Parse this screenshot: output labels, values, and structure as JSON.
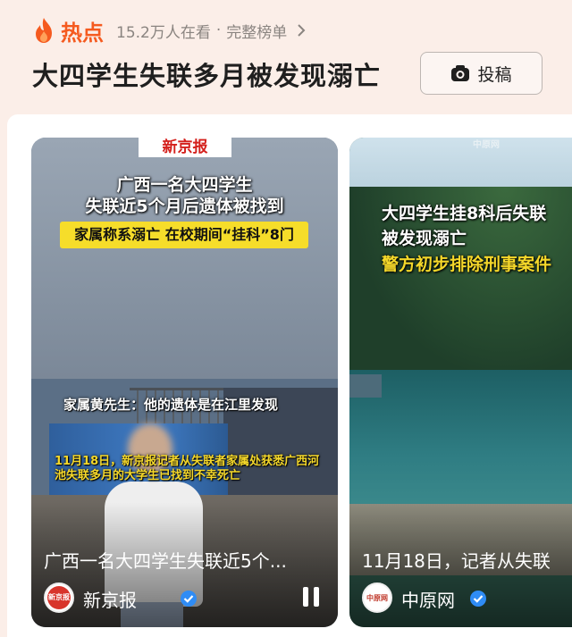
{
  "header": {
    "hot_label": "热点",
    "viewers": "15.2万人在看",
    "separator": "·",
    "full_list": "完整榜单",
    "headline": "大四学生失联多月被发现溺亡",
    "submit_label": "投稿"
  },
  "cards": [
    {
      "watermark": "新京报",
      "title_line1": "广西一名大四学生",
      "title_line2": "失联近5个月后遗体被找到",
      "highlight": "家属称系溺亡  在校期间“挂科”8门",
      "subtitle1": "家属黄先生：他的遗体是在江里发现",
      "subtitle2": "11月18日，新京报记者从失联者家属处获悉广西河池失联多月的大学生已找到不幸死亡",
      "caption": "广西一名大四学生失联近5个...",
      "source": "新京报",
      "avatar_text": "新京报"
    },
    {
      "watermark": "中原网",
      "title_line1": "大四学生挂8科后失联",
      "title_line2": "被发现溺亡",
      "title_line3": "警方初步排除刑事案件",
      "caption": "11月18日，记者从失联",
      "source": "中原网",
      "avatar_text": "中原网"
    }
  ],
  "colors": {
    "accent": "#f55a1f",
    "highlight_yellow": "#f6dd2a",
    "verified_blue": "#2f8cf5"
  },
  "icons": {
    "flame": "flame-icon",
    "chevron": "chevron-right-icon",
    "camera": "camera-icon",
    "verified": "verified-check-icon",
    "pause": "pause-icon"
  }
}
